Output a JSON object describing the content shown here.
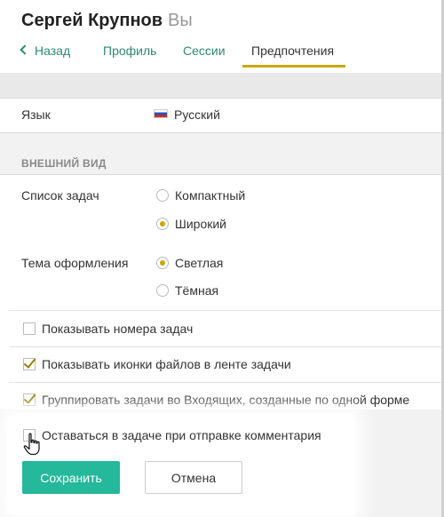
{
  "header": {
    "name": "Сергей Крупнов",
    "you_label": "Вы",
    "tabs": [
      {
        "label": "Назад"
      },
      {
        "label": "Профиль"
      },
      {
        "label": "Сессии"
      },
      {
        "label": "Предпочтения",
        "active": true
      }
    ]
  },
  "language": {
    "label": "Язык",
    "value": "Русский",
    "flag_icon": "russia-flag-icon"
  },
  "appearance": {
    "section_title": "ВНЕШНИЙ ВИД",
    "task_list": {
      "label": "Список задач",
      "options": [
        {
          "label": "Компактный",
          "selected": false
        },
        {
          "label": "Широкий",
          "selected": true
        }
      ]
    },
    "theme": {
      "label": "Тема оформления",
      "options": [
        {
          "label": "Светлая",
          "selected": true
        },
        {
          "label": "Тёмная",
          "selected": false
        }
      ]
    },
    "checkboxes": [
      {
        "label": "Показывать номера задач",
        "checked": false
      },
      {
        "label": "Показывать иконки файлов в ленте задачи",
        "checked": true
      },
      {
        "label": "Группировать задачи во Входящих, созданные по одной форме",
        "checked": true
      },
      {
        "label": "Оставаться в задаче при отправке комментария",
        "checked": false
      }
    ]
  },
  "actions": {
    "save_label": "Сохранить",
    "cancel_label": "Отмена"
  },
  "colors": {
    "accent": "#25b89a",
    "link": "#2b8a6f",
    "selection": "#c9a800"
  }
}
